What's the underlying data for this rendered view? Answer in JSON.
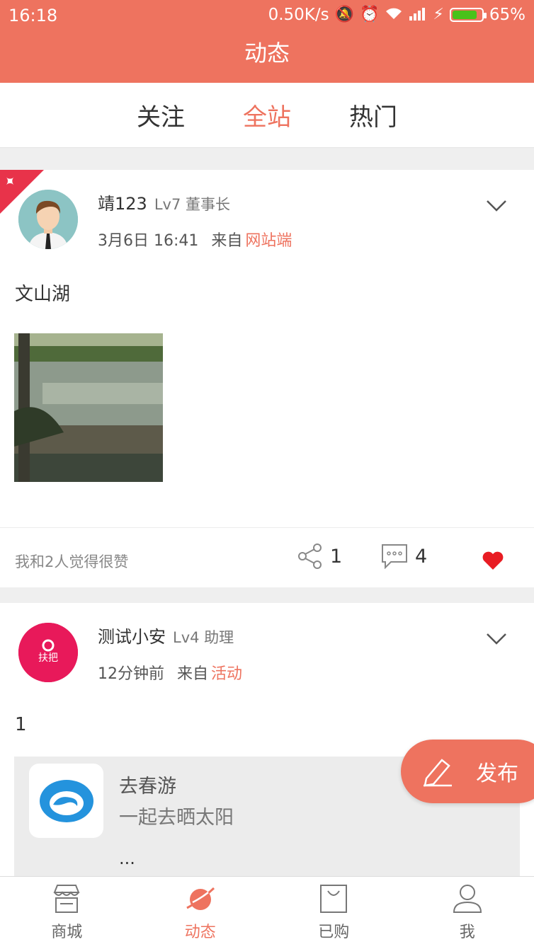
{
  "status_bar": {
    "time": "16:18",
    "speed": "0.50K/s",
    "battery": "65%"
  },
  "header": {
    "title": "动态"
  },
  "tabs": [
    {
      "label": "关注",
      "active": false
    },
    {
      "label": "全站",
      "active": true
    },
    {
      "label": "热门",
      "active": false
    }
  ],
  "posts": [
    {
      "user": {
        "name": "靖123",
        "level": "Lv7 董事长"
      },
      "time": "3月6日 16:41",
      "from_label": "来自",
      "source": "网站端",
      "text": "文山湖",
      "likes_text": "我和2人觉得很赞",
      "share_count": "1",
      "comment_count": "4"
    },
    {
      "user": {
        "name": "测试小安",
        "level": "Lv4 助理"
      },
      "time": "12分钟前",
      "from_label": "来自",
      "source": "活动",
      "text": "1",
      "shared": {
        "title": "去春游",
        "subtitle": "一起去晒太阳",
        "more": "..."
      }
    }
  ],
  "fab": {
    "label": "发布"
  },
  "bottom_nav": [
    {
      "label": "商城",
      "icon": "store-icon"
    },
    {
      "label": "动态",
      "icon": "planet-icon",
      "active": true
    },
    {
      "label": "已购",
      "icon": "bag-icon"
    },
    {
      "label": "我",
      "icon": "user-icon"
    }
  ],
  "colors": {
    "accent": "#ee735f",
    "ribbon": "#e8334a",
    "heart": "#e81c23"
  }
}
